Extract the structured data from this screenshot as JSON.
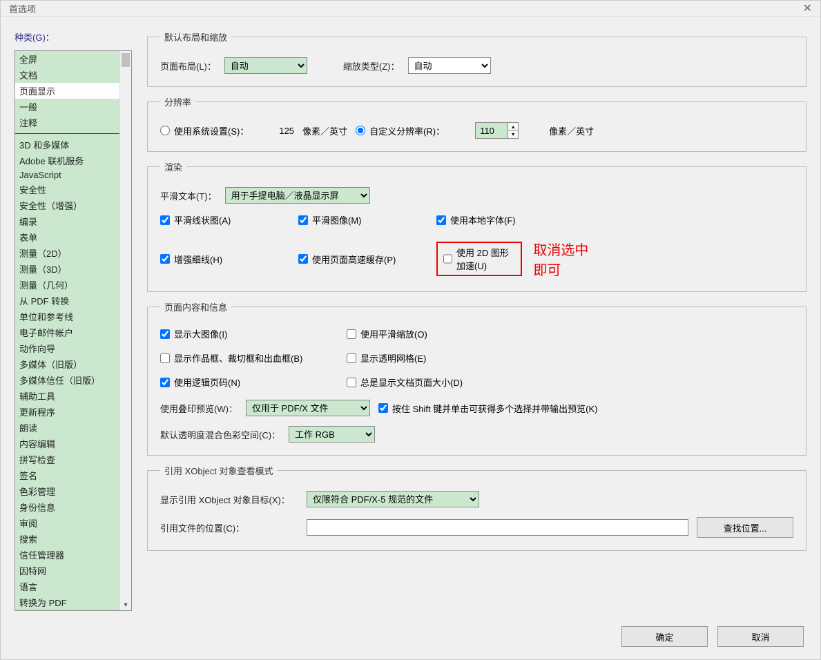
{
  "window": {
    "title": "首选项"
  },
  "sidebar": {
    "label": "种类(G)：",
    "items_top": [
      "全屏",
      "文档",
      "页面显示",
      "一般",
      "注释"
    ],
    "items_bottom": [
      "3D 和多媒体",
      "Adobe 联机服务",
      "JavaScript",
      "安全性",
      "安全性（增强）",
      "编录",
      "表单",
      "测量（2D）",
      "测量（3D）",
      "测量（几何）",
      "从 PDF 转换",
      "单位和参考线",
      "电子邮件帐户",
      "动作向导",
      "多媒体（旧版）",
      "多媒体信任（旧版）",
      "辅助工具",
      "更新程序",
      "朗读",
      "内容编辑",
      "拼写检查",
      "签名",
      "色彩管理",
      "身份信息",
      "审阅",
      "搜索",
      "信任管理器",
      "因特网",
      "语言",
      "转换为 PDF"
    ],
    "selected": "页面显示"
  },
  "layout": {
    "legend": "默认布局和缩放",
    "page_layout_label": "页面布局(L)：",
    "page_layout_value": "自动",
    "zoom_label": "缩放类型(Z)：",
    "zoom_value": "自动"
  },
  "resolution": {
    "legend": "分辨率",
    "use_system": "使用系统设置(S)：",
    "system_value": "125",
    "unit": "像素／英寸",
    "custom_label": "自定义分辨率(R)：",
    "custom_value": "110"
  },
  "render": {
    "legend": "渲染",
    "smooth_text_label": "平滑文本(T)：",
    "smooth_text_value": "用于手提电脑／液晶显示屏",
    "smooth_line": "平滑线状图(A)",
    "smooth_image": "平滑图像(M)",
    "local_fonts": "使用本地字体(F)",
    "enhance_thin": "增强细线(H)",
    "page_cache": "使用页面高速缓存(P)",
    "accel_2d": "使用 2D 图形加速(U)",
    "annotation": "取消选中即可"
  },
  "page_content": {
    "legend": "页面内容和信息",
    "large_images": "显示大图像(I)",
    "smooth_zoom": "使用平滑缩放(O)",
    "art_crop": "显示作品框、裁切框和出血框(B)",
    "transparency_grid": "显示透明网格(E)",
    "logical_page": "使用逻辑页码(N)",
    "always_doc_size": "总是显示文档页面大小(D)",
    "overprint_label": "使用叠印预览(W)：",
    "overprint_value": "仅用于 PDF/X 文件",
    "shift_preview": "按住 Shift 键并单击可获得多个选择并带输出预览(K)",
    "transparency_blend_label": "默认透明度混合色彩空间(C)：",
    "transparency_blend_value": "工作 RGB"
  },
  "xobject": {
    "legend": "引用 XObject 对象查看模式",
    "show_target_label": "显示引用 XObject 对象目标(X)：",
    "show_target_value": "仅限符合 PDF/X-5 规范的文件",
    "location_label": "引用文件的位置(C)：",
    "location_value": "",
    "browse_button": "查找位置..."
  },
  "footer": {
    "ok": "确定",
    "cancel": "取消"
  }
}
